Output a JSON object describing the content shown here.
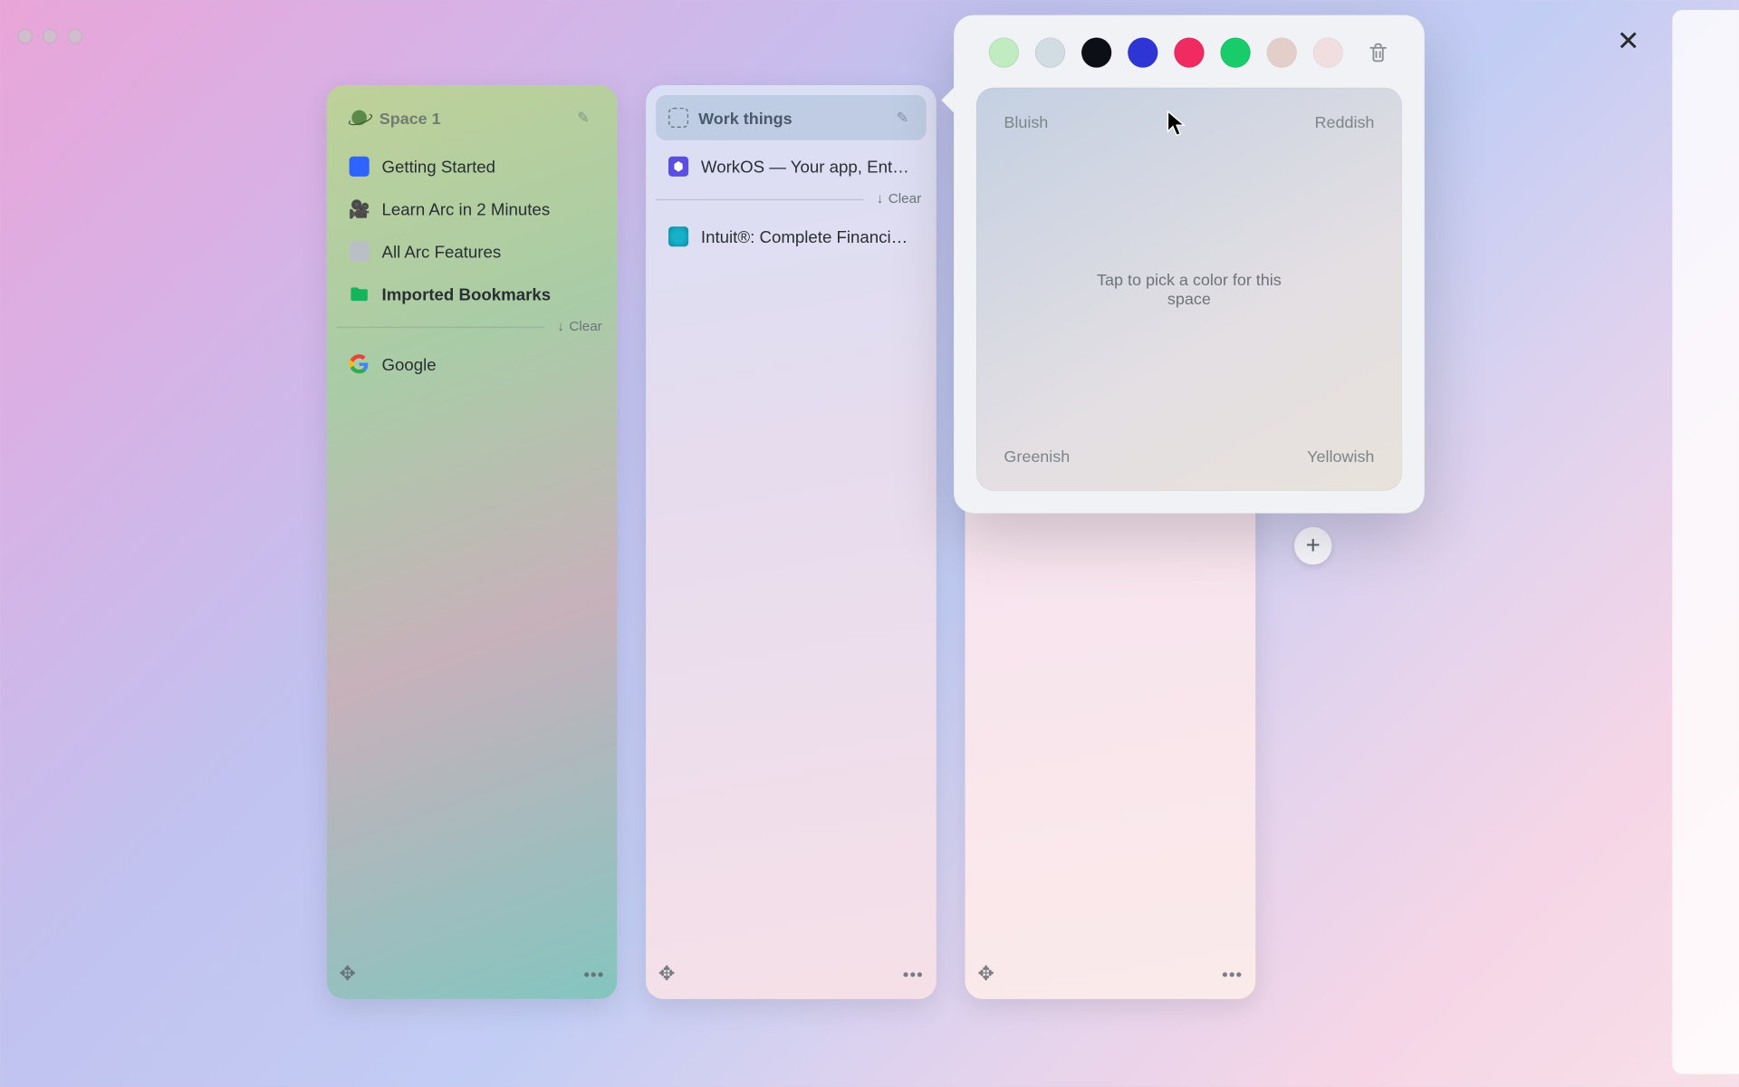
{
  "window": {
    "close_label": "✕"
  },
  "spaces": [
    {
      "title": "Space 1",
      "icon": "planet-icon",
      "items_pinned": [
        {
          "label": "Getting Started",
          "icon": "blue-square"
        },
        {
          "label": "Learn Arc in 2 Minutes",
          "icon": "camera"
        },
        {
          "label": "All Arc Features",
          "icon": "gray-square"
        },
        {
          "label": "Imported Bookmarks",
          "icon": "folder",
          "bold": true
        }
      ],
      "clear_label": "Clear",
      "items_open": [
        {
          "label": "Google",
          "icon": "google"
        }
      ]
    },
    {
      "title": "Work things",
      "icon": "dashed-square",
      "editing": true,
      "items_pinned": [
        {
          "label": "WorkOS — Your app, Ente…",
          "icon": "workos"
        }
      ],
      "clear_label": "Clear",
      "items_open": [
        {
          "label": "Intuit®: Complete Financi…",
          "icon": "intuit"
        }
      ]
    },
    {
      "title": "",
      "empty": true
    }
  ],
  "color_picker": {
    "swatches": [
      {
        "name": "mint",
        "hex": "#c1ecc1",
        "muted": false
      },
      {
        "name": "fog",
        "hex": "#d2dde3",
        "muted": false
      },
      {
        "name": "black",
        "hex": "#0d0f16",
        "muted": false
      },
      {
        "name": "blue",
        "hex": "#2f35d4",
        "muted": false
      },
      {
        "name": "pink",
        "hex": "#ef2b62",
        "muted": false
      },
      {
        "name": "green",
        "hex": "#18cc6a",
        "muted": false
      },
      {
        "name": "rose",
        "hex": "#d9b1a8",
        "muted": true
      },
      {
        "name": "blush",
        "hex": "#f0cfcf",
        "muted": true
      }
    ],
    "corners": {
      "tl": "Bluish",
      "tr": "Reddish",
      "bl": "Greenish",
      "br": "Yellowish"
    },
    "hint": "Tap to pick a color for this space"
  },
  "footer": {
    "add_label": "+"
  }
}
